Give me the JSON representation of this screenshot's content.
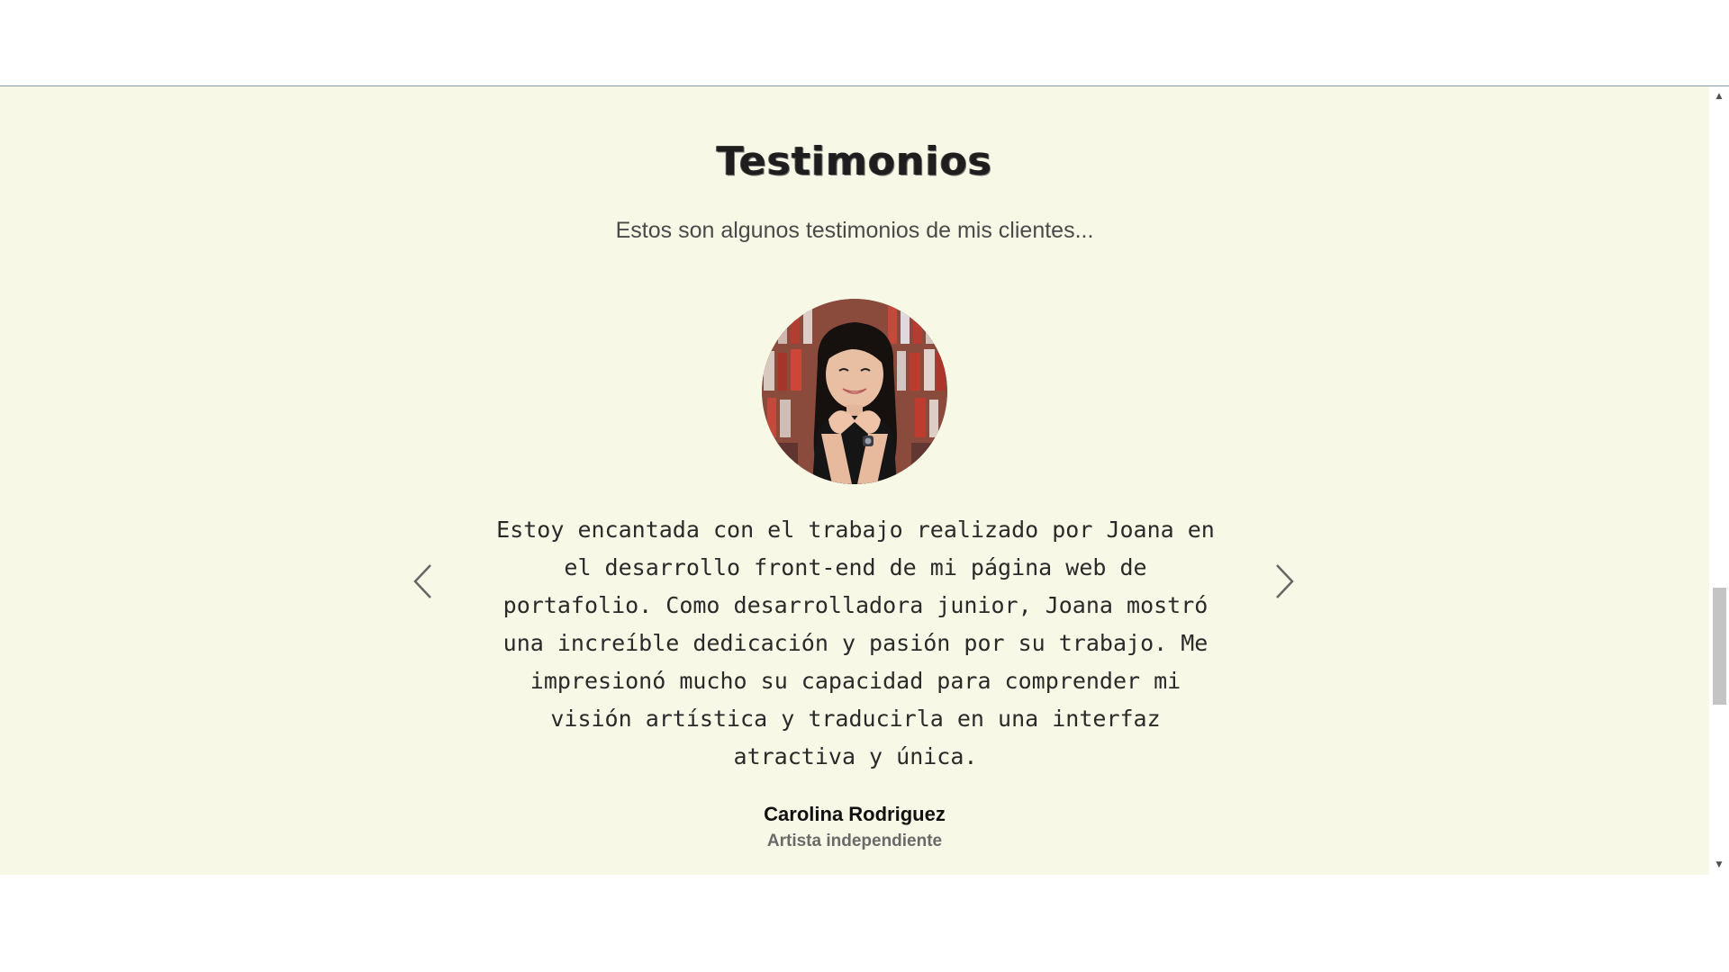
{
  "testimonials": {
    "title": "Testimonios",
    "subtitle": "Estos son algunos testimonios de mis clientes...",
    "current": {
      "quote": "Estoy encantada con el trabajo realizado por Joana en el desarrollo front-end de mi página web de portafolio. Como desarrolladora junior, Joana mostró una increíble dedicación y pasión por su trabajo. Me impresionó mucho su capacidad para comprender mi visión artística y traducirla en una interfaz atractiva y única.",
      "author": "Carolina Rodriguez",
      "role": "Artista independiente"
    },
    "prev_icon": "chevron-left-icon",
    "next_icon": "chevron-right-icon"
  },
  "colors": {
    "section_background": "#f8f8e6",
    "title_text": "#1e1e1e",
    "subtitle_text": "#4a4a4a",
    "quote_text": "#2a2a2a",
    "role_text": "#6a6a6a",
    "divider": "#8a9aa6"
  },
  "scrollbar": {
    "up_icon": "scroll-up-arrow-icon",
    "down_icon": "scroll-down-arrow-icon"
  }
}
